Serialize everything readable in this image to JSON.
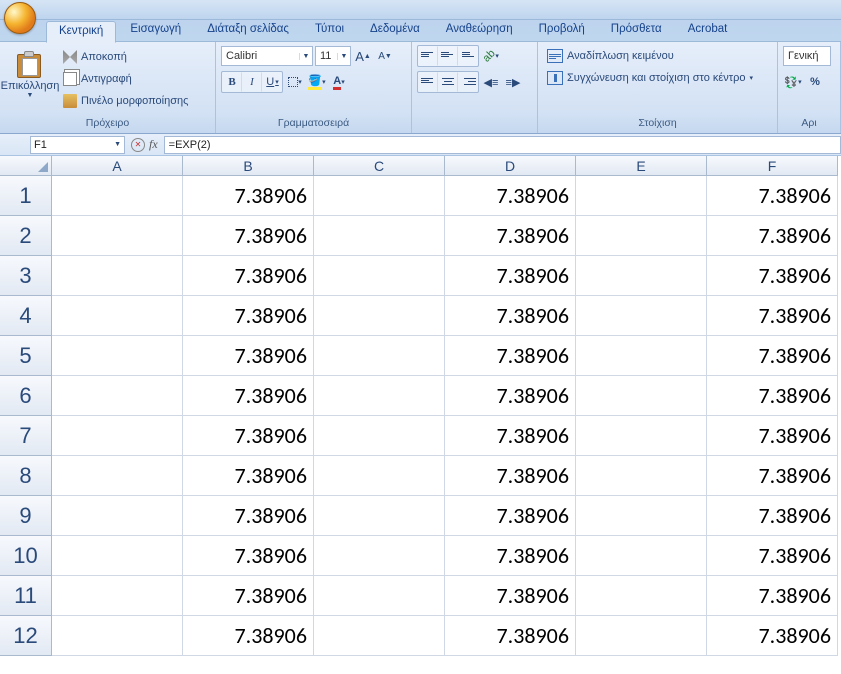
{
  "tabs": {
    "home": "Κεντρική",
    "insert": "Εισαγωγή",
    "layout": "Διάταξη σελίδας",
    "formulas": "Τύποι",
    "data": "Δεδομένα",
    "review": "Αναθεώρηση",
    "view": "Προβολή",
    "addins": "Πρόσθετα",
    "acrobat": "Acrobat"
  },
  "ribbon": {
    "clipboard": {
      "paste": "Επικόλληση",
      "cut": "Αποκοπή",
      "copy": "Αντιγραφή",
      "brush": "Πινέλο μορφοποίησης",
      "label": "Πρόχειρο"
    },
    "font": {
      "name": "Calibri",
      "size": "11",
      "label": "Γραμματοσειρά"
    },
    "align": {
      "wrap": "Αναδίπλωση κειμένου",
      "merge": "Συγχώνευση και στοίχιση στο κέντρο",
      "label": "Στοίχιση"
    },
    "number": {
      "format": "Γενική",
      "label": "Αρι"
    }
  },
  "name_box": "F1",
  "formula": "=EXP(2)",
  "columns": [
    "A",
    "B",
    "C",
    "D",
    "E",
    "F"
  ],
  "rows": [
    "1",
    "2",
    "3",
    "4",
    "5",
    "6",
    "7",
    "8",
    "9",
    "10",
    "11",
    "12"
  ],
  "cells": {
    "B": [
      "7.38906",
      "7.38906",
      "7.38906",
      "7.38906",
      "7.38906",
      "7.38906",
      "7.38906",
      "7.38906",
      "7.38906",
      "7.38906",
      "7.38906",
      "7.38906"
    ],
    "D": [
      "7.38906",
      "7.38906",
      "7.38906",
      "7.38906",
      "7.38906",
      "7.38906",
      "7.38906",
      "7.38906",
      "7.38906",
      "7.38906",
      "7.38906",
      "7.38906"
    ],
    "F": [
      "7.38906",
      "7.38906",
      "7.38906",
      "7.38906",
      "7.38906",
      "7.38906",
      "7.38906",
      "7.38906",
      "7.38906",
      "7.38906",
      "7.38906",
      "7.38906"
    ]
  }
}
